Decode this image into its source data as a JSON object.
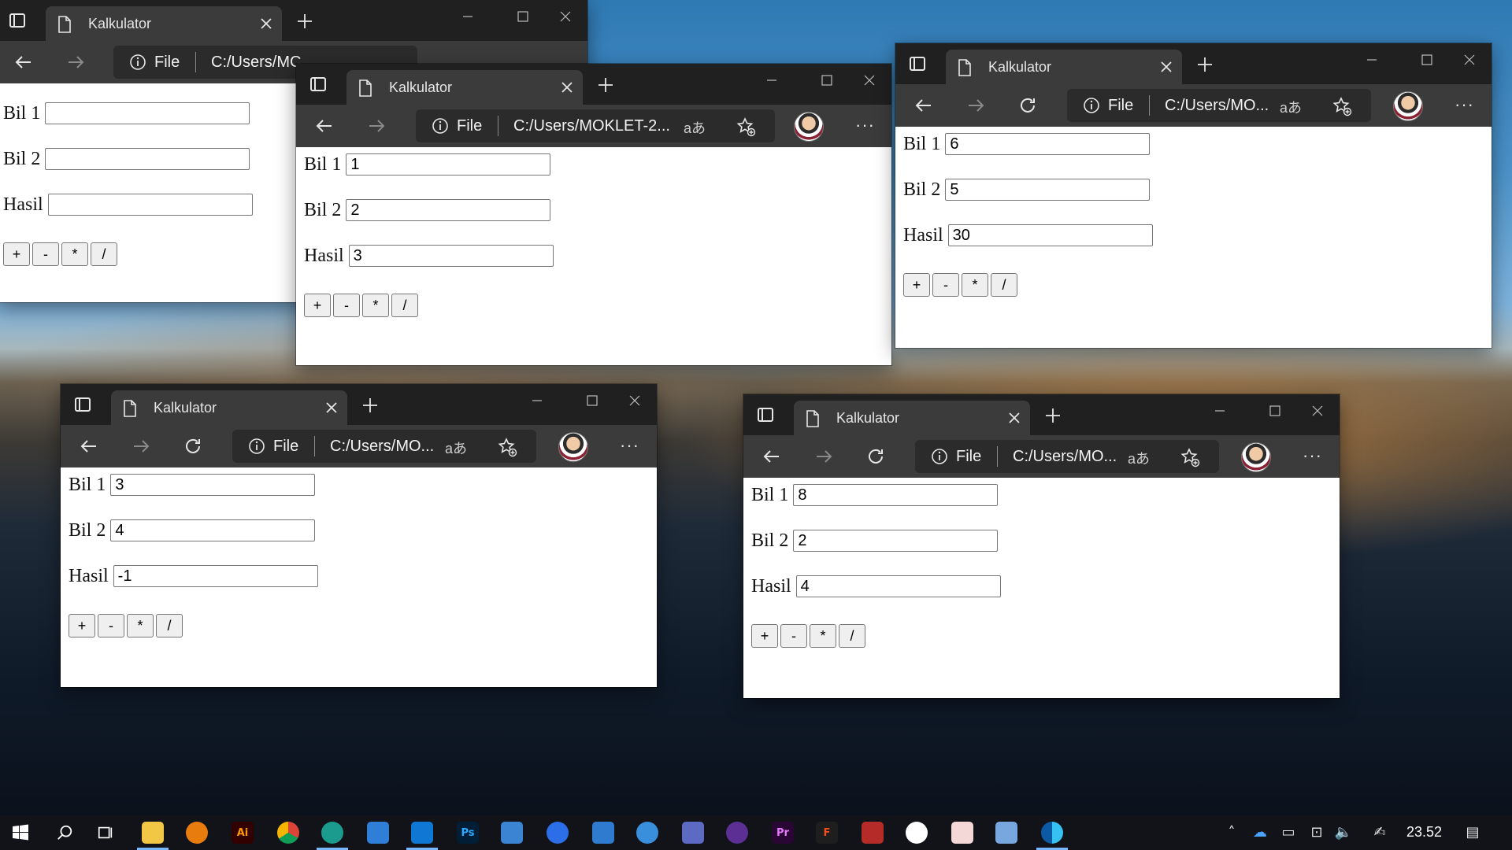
{
  "browser": {
    "tab_title": "Kalkulator",
    "address_scheme": "File",
    "address_url_full": "C:/Users/MOKLET-2...",
    "address_url_short": "C:/Users/MO...",
    "address_url_cut": "C:/Users/MC",
    "read_aloud_glyph": "aあ",
    "more_glyph": "···"
  },
  "form": {
    "bil1_label": "Bil 1",
    "bil2_label": "Bil 2",
    "hasil_label": "Hasil",
    "ops": [
      "+",
      "-",
      "*",
      "/"
    ]
  },
  "windows": [
    {
      "id": "back",
      "bil1": "",
      "bil2": "",
      "hasil": ""
    },
    {
      "id": "add",
      "bil1": "1",
      "bil2": "2",
      "hasil": "3"
    },
    {
      "id": "multiply",
      "bil1": "6",
      "bil2": "5",
      "hasil": "30"
    },
    {
      "id": "subtract",
      "bil1": "3",
      "bil2": "4",
      "hasil": "-1"
    },
    {
      "id": "divide",
      "bil1": "8",
      "bil2": "2",
      "hasil": "4"
    }
  ],
  "taskbar": {
    "clock": "23.52",
    "apps": [
      "start",
      "search",
      "task-view",
      "file-explorer",
      "blender",
      "illustrator",
      "chrome",
      "edge-dev",
      "mail",
      "vscode",
      "photoshop",
      "fl-studio",
      "cortana",
      "app-blue",
      "app-mixed",
      "app-check",
      "github-desktop",
      "premiere",
      "figma",
      "app-red",
      "app-white",
      "app-anime",
      "3d-viewer",
      "edge"
    ]
  }
}
